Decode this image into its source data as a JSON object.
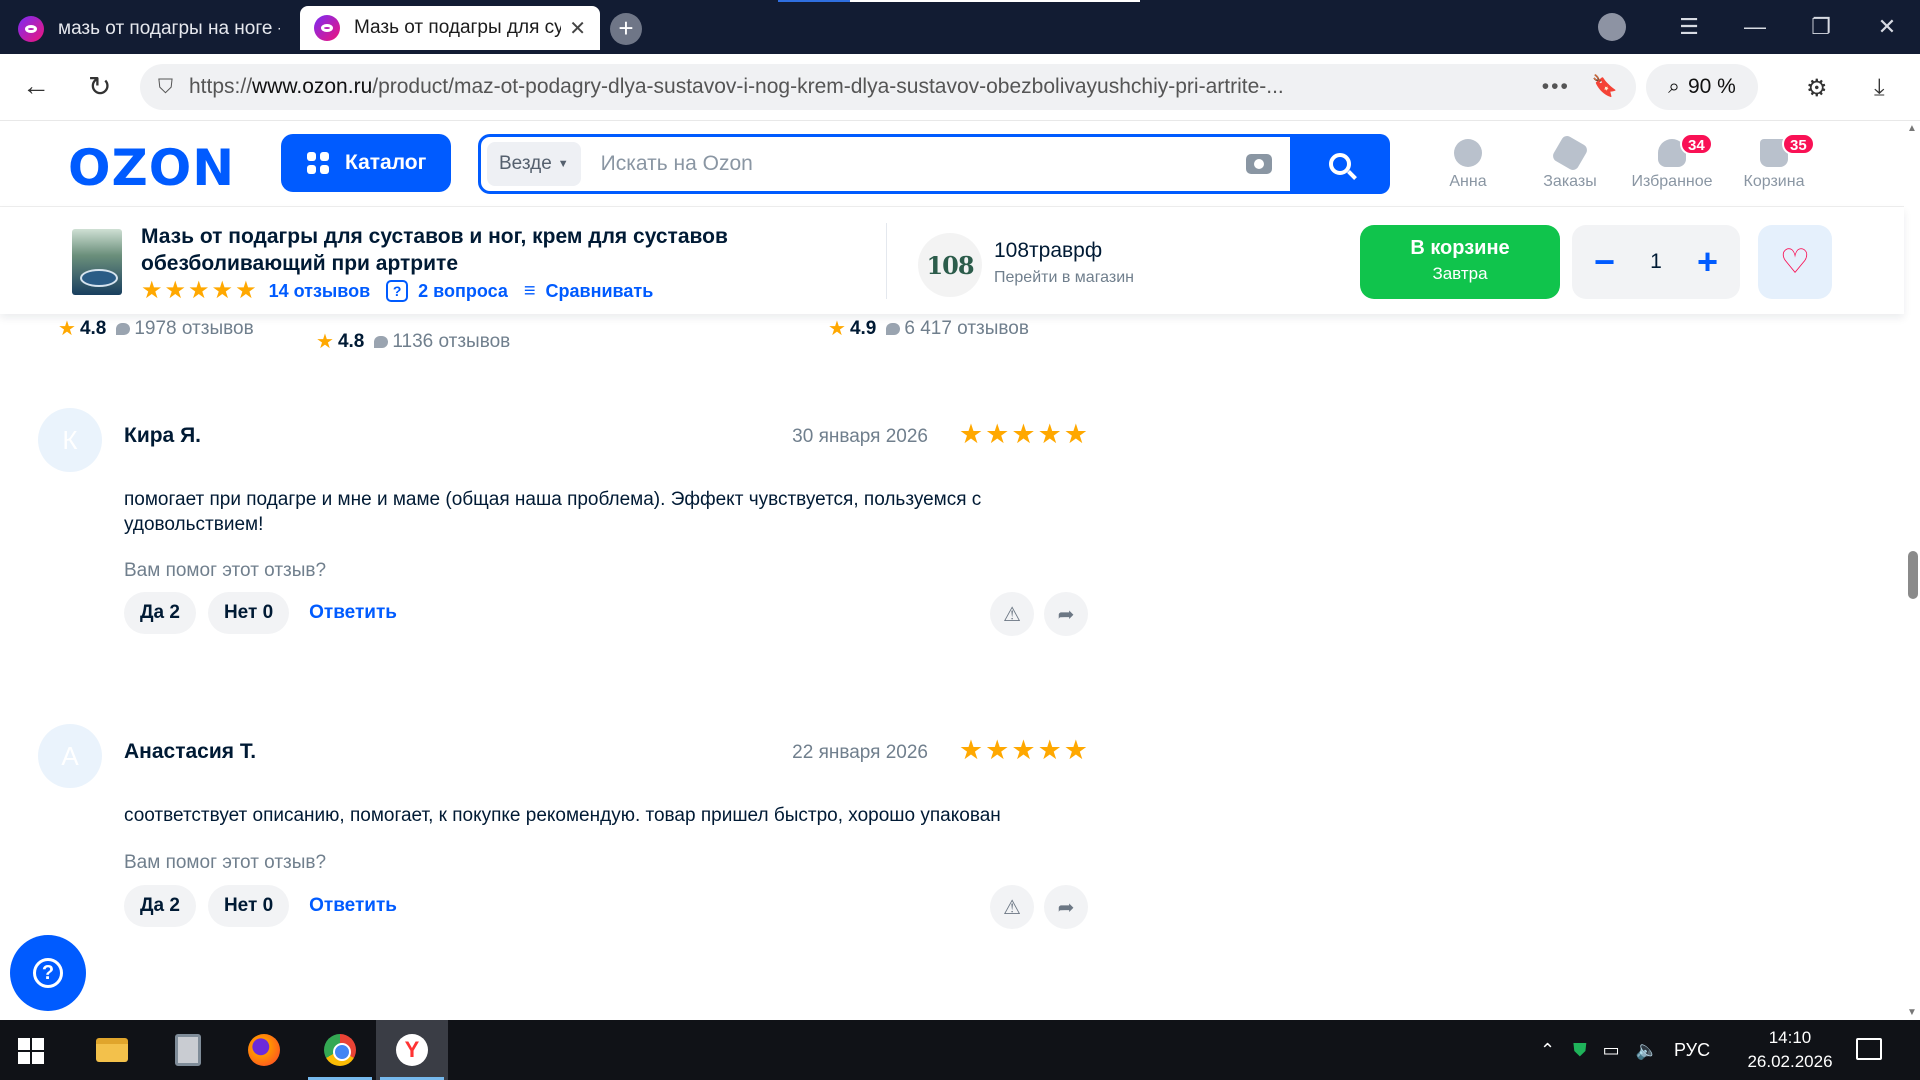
{
  "browser": {
    "tabs": [
      {
        "title": "мазь от подагры на ноге -"
      },
      {
        "title": "Мазь от подагры для суставов",
        "close": "✕"
      }
    ],
    "new_tab": "+",
    "url_host": "www.ozon.ru",
    "url_prefix": "https://",
    "url_path": "/product/maz-ot-podagry-dlya-sustavov-i-nog-krem-dlya-sustavov-obezbolivayushchiy-pri-artrite-...",
    "zoom": "90 %"
  },
  "header": {
    "logo": "OZON",
    "catalog_label": "Каталог",
    "search_scope": "Везде",
    "search_placeholder": "Искать на Ozon",
    "nav": [
      {
        "label": "Анна",
        "icon": "user-icon"
      },
      {
        "label": "Заказы",
        "icon": "box-icon"
      },
      {
        "label": "Избранное",
        "icon": "heart-icon",
        "badge": "34"
      },
      {
        "label": "Корзина",
        "icon": "cart-icon",
        "badge": "35"
      }
    ]
  },
  "product": {
    "title": "Мазь от подагры для суставов и ног, крем для суставов обезболивающий при артрите",
    "reviews_link": "14 отзывов",
    "questions_link": "2 вопроса",
    "compare_link": "Сравнивать",
    "rating_stars": 5,
    "shop_logo": "108",
    "shop_name": "108траврф",
    "shop_link": "Перейти в магазин",
    "cart_button": {
      "line1": "В корзине",
      "line2": "Завтра"
    },
    "quantity": "1",
    "minus": "−",
    "plus": "+"
  },
  "recommendations": [
    {
      "rating": "4.8",
      "count": "1978 отзывов"
    },
    {
      "rating": "4.8",
      "count": "1136 отзывов"
    },
    {
      "rating": "4.9",
      "count": "6 417 отзывов"
    }
  ],
  "reviews": [
    {
      "initial": "К",
      "author": "Кира Я.",
      "date": "30 января 2026",
      "stars": 5,
      "text": "помогает при подагре и мне и маме (общая наша проблема). Эффект чувствуется, пользуемся с удовольствием!",
      "helpful_q": "Вам помог этот отзыв?",
      "yes": "Да 2",
      "no": "Нет 0",
      "reply": "Ответить"
    },
    {
      "initial": "А",
      "author": "Анастасия Т.",
      "date": "22 января 2026",
      "stars": 5,
      "text": "соответствует описанию, помогает, к покупке рекомендую. товар пришел быстро, хорошо упакован",
      "helpful_q": "Вам помог этот отзыв?",
      "yes": "Да 2",
      "no": "Нет 0",
      "reply": "Ответить"
    }
  ],
  "help_button": "?",
  "taskbar": {
    "language": "РУС",
    "time": "14:10",
    "date": "26.02.2026"
  },
  "colors": {
    "ozon_blue": "#005bff",
    "cart_green": "#10c44c",
    "star": "#ffa800",
    "badge": "#f91155"
  }
}
